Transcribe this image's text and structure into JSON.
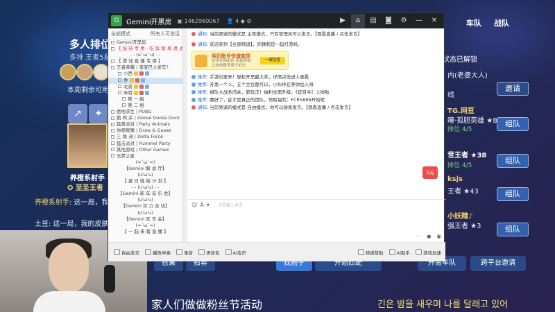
{
  "app": {
    "title": "Gemini开黑房",
    "room_id": "1462960067",
    "user_count": "4"
  },
  "sidebar": {
    "header_left": "全部模式",
    "header_right": "所有人可说话",
    "rows": [
      {
        "text": "Gemini开黑房",
        "cls": ""
      },
      {
        "text": "【 接 待 专 用 - 吃 饭 暂 离 请 进 】",
        "cls": "red"
      },
      {
        "text": "-  - (u' ω' u) -  -",
        "cls": "center"
      },
      {
        "text": "【 游 戏 直 播 专 用 】",
        "cls": ""
      },
      {
        "text": "王者荣耀 | 宝宝巴士发车?",
        "cls": ""
      },
      {
        "text": "小西",
        "cls": "ch"
      },
      {
        "text": "乔",
        "cls": "ch sel"
      },
      {
        "text": "北夜",
        "cls": "ch"
      },
      {
        "text": "米特",
        "cls": "ch"
      },
      {
        "text": "第 一 组",
        "cls": "ch2"
      },
      {
        "text": "第 二 组",
        "cls": "ch2"
      },
      {
        "text": "绝地求生 | PUBG",
        "cls": ""
      },
      {
        "text": "鹅 鸭 杀 | Goose Goose Duck",
        "cls": ""
      },
      {
        "text": "猛兽派对 | Party Animals",
        "cls": ""
      },
      {
        "text": "你画我猜 | Draw & Guess",
        "cls": ""
      },
      {
        "text": "三 角 洲 | Delta Force",
        "cls": ""
      },
      {
        "text": "猛击派对 | Pummel Party",
        "cls": ""
      },
      {
        "text": "其他游戏 | Other Games",
        "cls": ""
      },
      {
        "text": "元梦之星",
        "cls": ""
      },
      {
        "text": "(=´ω`=)",
        "cls": "center"
      },
      {
        "text": "【Gemini 解 说 厅】",
        "cls": "center"
      },
      {
        "text": "(u'ω'u)",
        "cls": "center"
      },
      {
        "text": "【 夏 日 晚 秘 计 划 】",
        "cls": "center"
      },
      {
        "text": "-  - (u'ω'u) -  -",
        "cls": "center"
      },
      {
        "text": "【Gemini 新 年 音 乐 会】",
        "cls": "center"
      },
      {
        "text": "(u'ω'u)",
        "cls": "center"
      },
      {
        "text": "【Gemini 耳 力 合 坊】",
        "cls": "center"
      },
      {
        "text": "(u'ω'u)",
        "cls": "center"
      },
      {
        "text": "【Gemini 欢 乐 会】",
        "cls": "center"
      },
      {
        "text": "(=´ω`=)",
        "cls": "center"
      },
      {
        "text": "【 一 起 来 看 直 播 】",
        "cls": "center"
      }
    ]
  },
  "messages": [
    {
      "dot": "#e06060",
      "label": "通知:",
      "text": "当前频道的模式是 主席模式，只有管理员可以发言。【观看直播 / 点击发言】"
    },
    {
      "dot": "#e06060",
      "label": "通知:",
      "text": "欢迎来到【全部频道】，同禧和您一起打游戏。"
    },
    {
      "dot": "#5aa0e0",
      "label": "推荐:",
      "text": "手游也要来！轻松开黑赢大奖，详情点击进入查看"
    },
    {
      "dot": "#5aa0e0",
      "label": "推荐:",
      "text": "开黑一个人，五个主位都可以，小伙伴在等你加入呀"
    },
    {
      "dot": "#5aa0e0",
      "label": "推荐:",
      "text": "组队大战多闯关，新玩法！福利全面升级，《征召令》上线啦"
    },
    {
      "dot": "#5aa0e0",
      "label": "推荐:",
      "text": "赛好了，这才是真正的团队，领取福利：FCR5886开始呢"
    },
    {
      "dot": "#e06060",
      "label": "通知:",
      "text": "当前频道的模式是 自由模式，你可以随意发言。【观看直播 / 点击发言】"
    }
  ],
  "promo": {
    "title": "网页账号快速变现",
    "sub1": "支持全网出价 多家竞拍",
    "sub2": "让你的账号卖个好价",
    "button": "一键估值"
  },
  "input": {
    "placeholder": "点击输入发言"
  },
  "bottombar": {
    "items": [
      "自由发言",
      "播放伴奏",
      "录音",
      "语音包",
      "AI变声"
    ],
    "right_items": [
      "频道赞助",
      "AI助手",
      "游戏加速"
    ]
  },
  "game": {
    "title": "多人排位",
    "subtitle": "多排 王者5星",
    "remaining": "本周剩余可用",
    "player_name": "养橙系射手",
    "player_rank": "至圣王者",
    "chat1_name": "养橙系射手",
    "chat1_text": ": 这一局，我",
    "chat2_name": "土豆",
    "chat2_text": ": 这一局，我的皮肤",
    "nav": [
      "车队",
      "战队"
    ],
    "status": "状态已解锁",
    "rline1": "内(老婆大人)",
    "rline2": "线",
    "invite": "邀请",
    "players": [
      {
        "name": "TG.网豆",
        "hero": "瞳·孤胆英雄 ★83",
        "sub": "排位 4/5",
        "btn": "组队"
      },
      {
        "name": "世王者 ★38",
        "hero": "",
        "sub": "排位 4/5",
        "btn": "组队"
      },
      {
        "name": "ksjs",
        "hero": "王者 ★43",
        "sub": "",
        "btn": "组队"
      },
      {
        "name": "小妖精♪",
        "hero": "强王者 ★3",
        "sub": "",
        "btn": "组队"
      }
    ],
    "buttons": {
      "summon": "召集",
      "recruit": "招募",
      "find": "找搭子",
      "start": "开始匹配",
      "open_team": "开黑车队",
      "cross": "跨平台邀请"
    },
    "lyric_left": "家人们做做粉丝节活动",
    "lyric_right": "긴은 밤을 새우며 나를 달래고 있어",
    "sticker": "5元"
  }
}
